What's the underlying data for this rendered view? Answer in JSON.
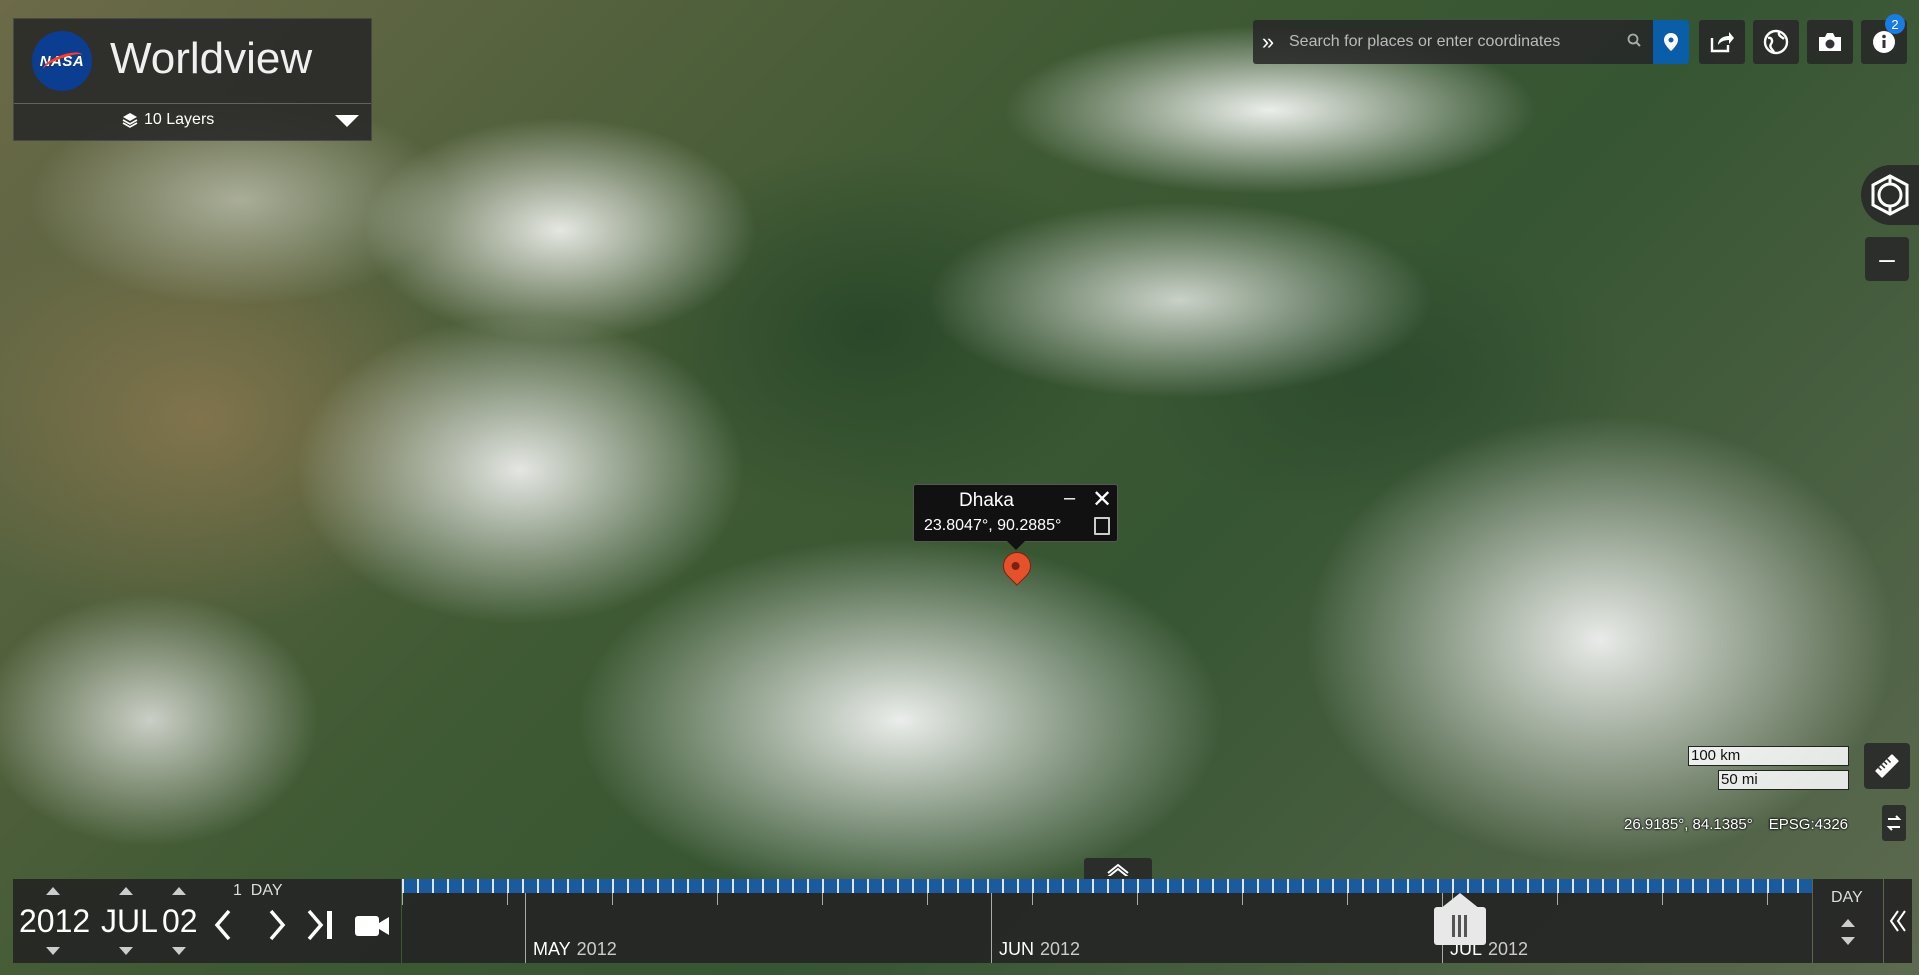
{
  "app": {
    "title": "Worldview",
    "logo_text": "NASA"
  },
  "layers": {
    "label": "10 Layers"
  },
  "search": {
    "placeholder": "Search for places or enter coordinates"
  },
  "toolbar": {
    "info_badge": "2"
  },
  "popup": {
    "name": "Dhaka",
    "coords": "23.8047°, 90.2885°"
  },
  "scale": {
    "km": "100 km",
    "mi": "50 mi"
  },
  "coords": {
    "value": "26.9185°, 84.1385°",
    "projection": "EPSG:4326"
  },
  "date": {
    "year": "2012",
    "month": "JUL",
    "day": "02",
    "interval_count": "1",
    "interval_unit": "DAY"
  },
  "timeline": {
    "months": [
      {
        "month": "MAY",
        "year": "2012"
      },
      {
        "month": "JUN",
        "year": "2012"
      },
      {
        "month": "JUL",
        "year": "2012"
      }
    ],
    "zoom_label": "DAY"
  },
  "colors": {
    "accent": "#0a5ea8",
    "timeline_strip": "#1b5a9c",
    "marker": "#e4512a",
    "badge": "#1a7ce0"
  }
}
